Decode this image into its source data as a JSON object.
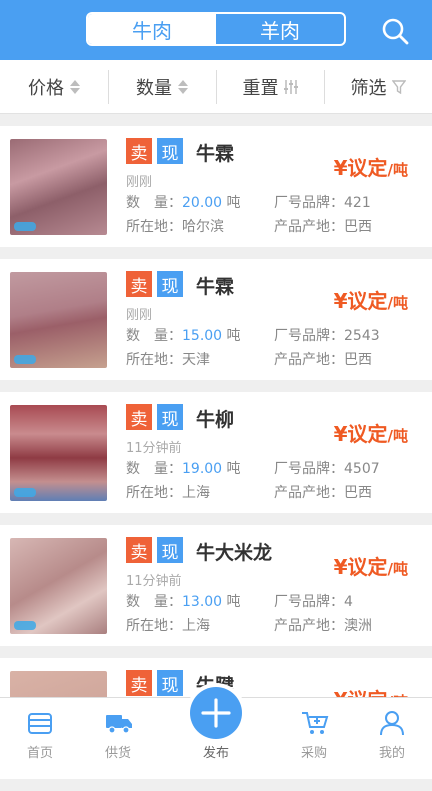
{
  "header": {
    "tabs": [
      {
        "label": "牛肉",
        "active": true
      },
      {
        "label": "羊肉",
        "active": false
      }
    ],
    "search_icon": "search-icon"
  },
  "filters": [
    {
      "label": "价格",
      "icon": "sort-arrows"
    },
    {
      "label": "数量",
      "icon": "sort-arrows"
    },
    {
      "label": "重置",
      "icon": "reset-icon"
    },
    {
      "label": "筛选",
      "icon": "filter-funnel-icon"
    }
  ],
  "labels": {
    "sell_badge": "卖",
    "spot_badge": "现",
    "qty_label": "数　量：",
    "qty_unit": "吨",
    "brand_label": "厂号品牌：",
    "location_label": "所在地：",
    "origin_label": "产品产地：",
    "price_text": "¥议定",
    "price_unit": "/吨"
  },
  "listings": [
    {
      "title": "牛霖",
      "time": "刚刚",
      "quantity": "20.00",
      "brand": "421",
      "location": "哈尔滨",
      "origin": "巴西"
    },
    {
      "title": "牛霖",
      "time": "刚刚",
      "quantity": "15.00",
      "brand": "2543",
      "location": "天津",
      "origin": "巴西"
    },
    {
      "title": "牛柳",
      "time": "11分钟前",
      "quantity": "19.00",
      "brand": "4507",
      "location": "上海",
      "origin": "巴西"
    },
    {
      "title": "牛大米龙",
      "time": "11分钟前",
      "quantity": "13.00",
      "brand": "4",
      "location": "上海",
      "origin": "澳洲"
    },
    {
      "title": "牛腱",
      "time": "",
      "quantity": "",
      "brand": "",
      "location": "",
      "origin": ""
    }
  ],
  "tabbar": [
    {
      "label": "首页",
      "icon": "home-icon"
    },
    {
      "label": "供货",
      "icon": "truck-icon"
    },
    {
      "label": "发布",
      "icon": "plus-icon"
    },
    {
      "label": "采购",
      "icon": "cart-icon"
    },
    {
      "label": "我的",
      "icon": "user-icon"
    }
  ],
  "colors": {
    "primary": "#4a9ff2",
    "sell": "#ef6238",
    "price": "#ef5a23"
  }
}
